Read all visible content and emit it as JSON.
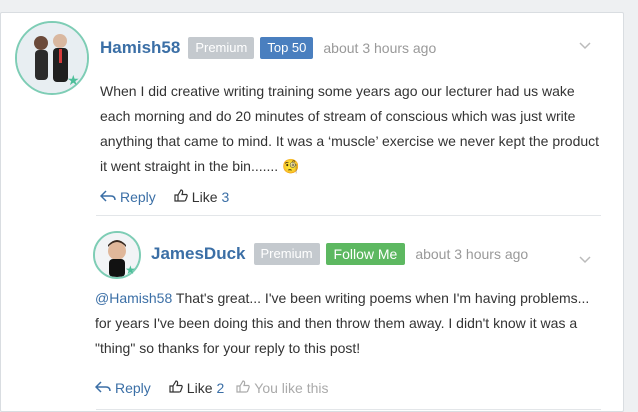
{
  "comments": [
    {
      "username": "Hamish58",
      "badges": [
        "Premium",
        "Top 50"
      ],
      "time": "about 3 hours ago",
      "text": "When I did creative writing training some years ago our lecturer had us wake each morning and do 20 minutes of stream of conscious which was just write anything that came to mind. It was a ‘muscle’ exercise we never kept the product it went straight in the bin.......",
      "emoji": "🧐",
      "reply_label": "Reply",
      "like_label": "Like",
      "like_count": "3"
    },
    {
      "username": "JamesDuck",
      "badges": [
        "Premium",
        "Follow Me"
      ],
      "time": "about 3 hours ago",
      "mention": "@Hamish58",
      "text": " That's great... I've been writing poems when I'm having problems... for years I've been doing this and then throw them away. I didn't know it was a \"thing\" so thanks for your reply to this post!",
      "reply_label": "Reply",
      "like_label": "Like",
      "like_count": "2",
      "you_like_label": "You like this"
    }
  ],
  "colors": {
    "link": "#3b6fa6",
    "premium": "#c4c9ce",
    "top50": "#4a7fbf",
    "follow": "#5db861",
    "avatar_ring": "#7ecdb5"
  },
  "icons": [
    "reply-icon",
    "thumbs-up-icon",
    "chevron-down-icon",
    "star-icon"
  ]
}
